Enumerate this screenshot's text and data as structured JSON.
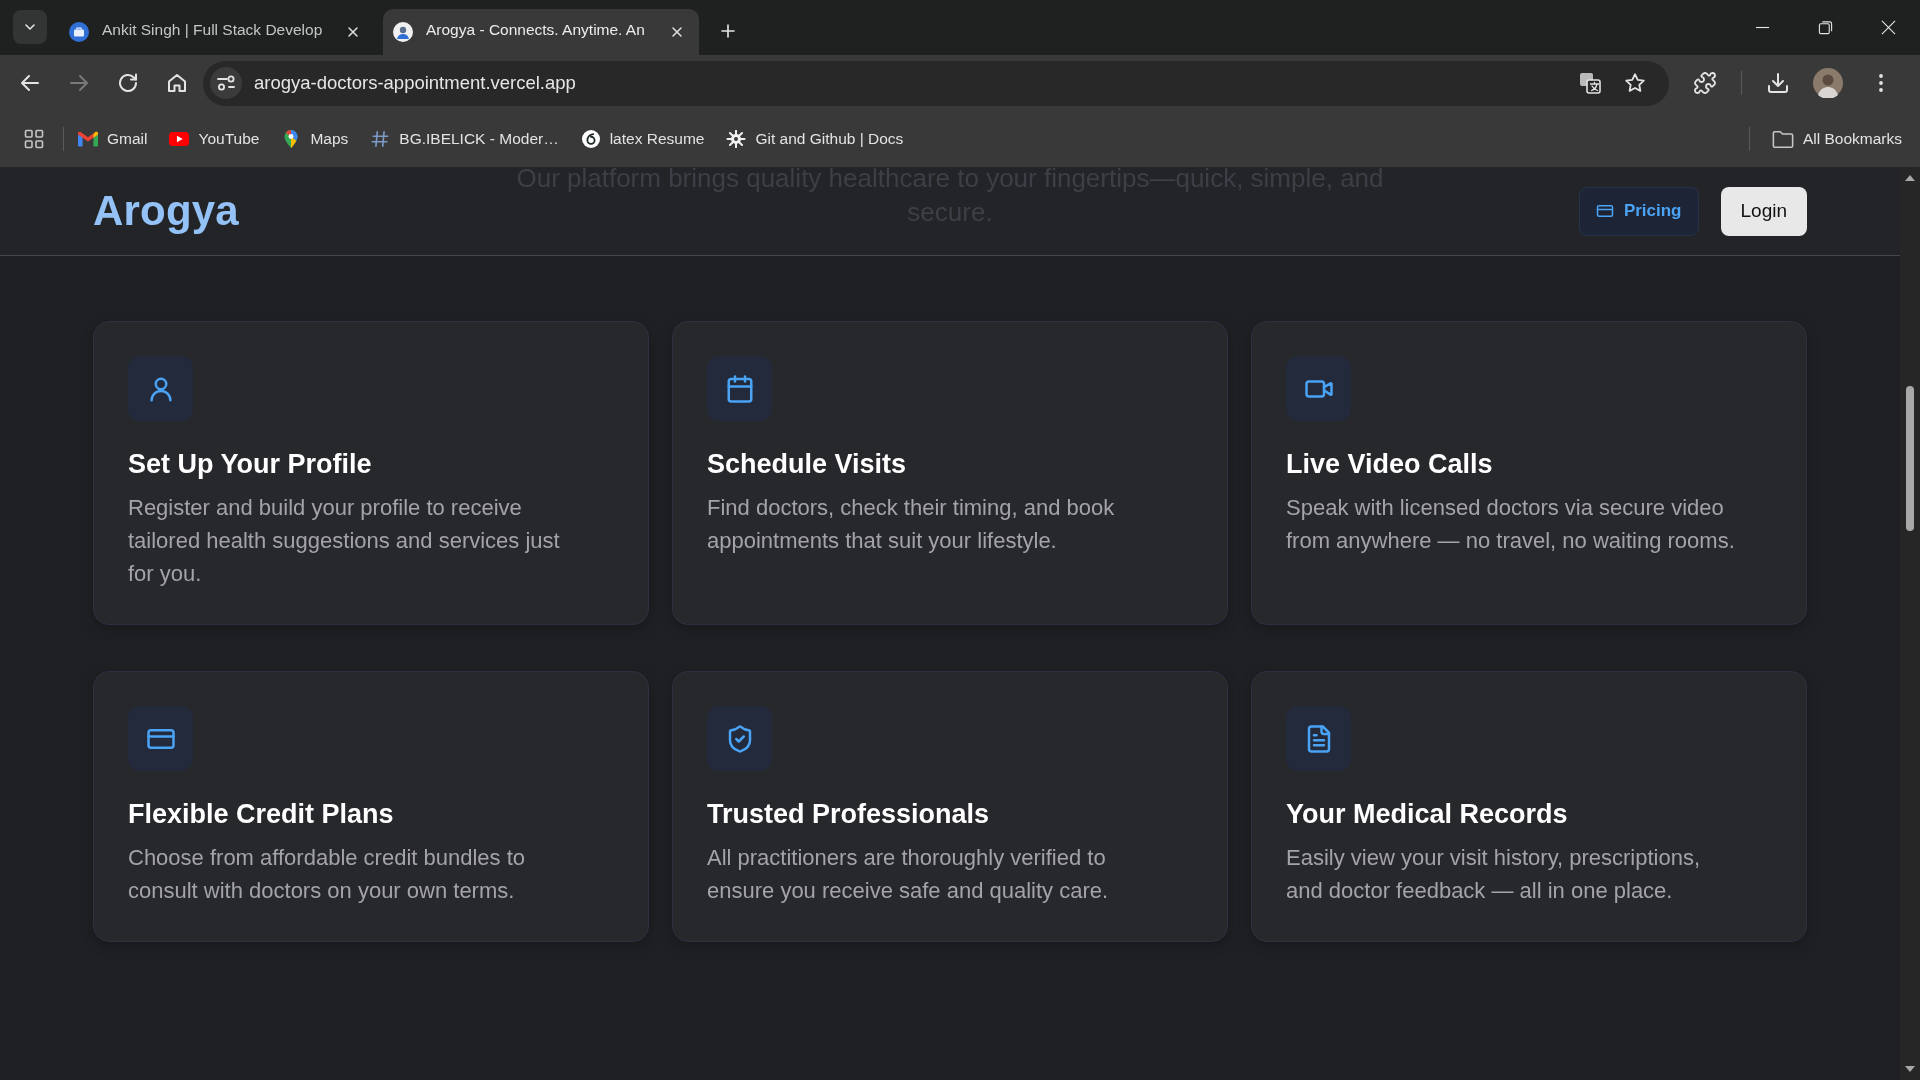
{
  "browser": {
    "tabs": [
      {
        "kind": "portfolio",
        "title": "Ankit Singh | Full Stack Develop",
        "selected": false
      },
      {
        "kind": "site",
        "title": "Arogya - Connects. Anytime. An",
        "selected": true
      }
    ],
    "forward": {
      "disabled": true
    },
    "address": "arogya-doctors-appointment.vercel.app",
    "bookmarks": [
      {
        "kind": "mail",
        "label": "Gmail"
      },
      {
        "kind": "video",
        "label": "YouTube"
      },
      {
        "kind": "pin",
        "label": "Maps"
      },
      {
        "kind": "hash",
        "label": "BG.IBELICK - Moder…"
      },
      {
        "kind": "swirl",
        "label": "latex Resume"
      },
      {
        "kind": "gear",
        "label": "Git and Github | Docs"
      }
    ],
    "all_bookmarks": "All Bookmarks"
  },
  "header": {
    "logo": "Arogya",
    "backdrop_text": "Our platform brings quality healthcare to your fingertips—quick, simple, and secure.",
    "pricing_button": "Pricing",
    "login_button": "Login"
  },
  "features": [
    {
      "kind": "profile",
      "title": "Set Up Your Profile",
      "description": "Register and build your profile to receive tailored health suggestions and services just for you."
    },
    {
      "kind": "calendar",
      "title": "Schedule Visits",
      "description": "Find doctors, check their timing, and book appointments that suit your lifestyle."
    },
    {
      "kind": "video",
      "title": "Live Video Calls",
      "description": "Speak with licensed doctors via secure video from anywhere — no travel, no waiting rooms."
    },
    {
      "kind": "card",
      "title": "Flexible Credit Plans",
      "description": "Choose from affordable credit bundles to consult with doctors on your own terms."
    },
    {
      "kind": "shield",
      "title": "Trusted Professionals",
      "description": "All practitioners are thoroughly verified to ensure you receive safe and quality care."
    },
    {
      "kind": "document",
      "title": "Your Medical Records",
      "description": "Easily view your visit history, prescriptions, and doctor feedback — all in one place."
    }
  ]
}
